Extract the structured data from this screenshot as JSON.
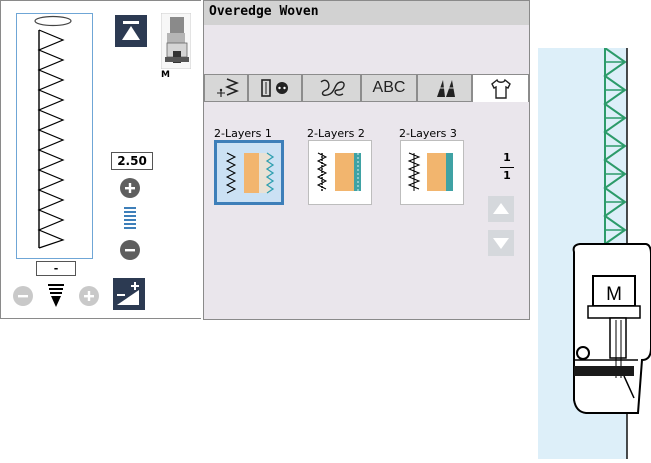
{
  "stitch": {
    "width_value": "2.50",
    "length_value": "-",
    "foot_letter": "M"
  },
  "mode": {
    "title": "Overedge Woven"
  },
  "tabs": [
    {
      "icon": "utility-stitch-icon",
      "label": ""
    },
    {
      "icon": "buttonhole-icon",
      "label": ""
    },
    {
      "icon": "decorative-stitch-icon",
      "label": ""
    },
    {
      "icon": "",
      "label": "ABC"
    },
    {
      "icon": "quilt-stitch-icon",
      "label": ""
    },
    {
      "icon": "shirt-icon",
      "label": "",
      "active": true
    }
  ],
  "patterns": [
    {
      "label": "2-Layers 1",
      "selected": true
    },
    {
      "label": "2-Layers 2",
      "selected": false
    },
    {
      "label": "2-Layers 3",
      "selected": false
    }
  ],
  "page": {
    "current": "1",
    "total": "1"
  },
  "illustration": {
    "foot_letter": "M"
  },
  "colors": {
    "accent": "#3e7fb9",
    "fabric": "#ddeff9",
    "stitch": "#2c9b6a",
    "dark_button": "#2c3a52"
  }
}
